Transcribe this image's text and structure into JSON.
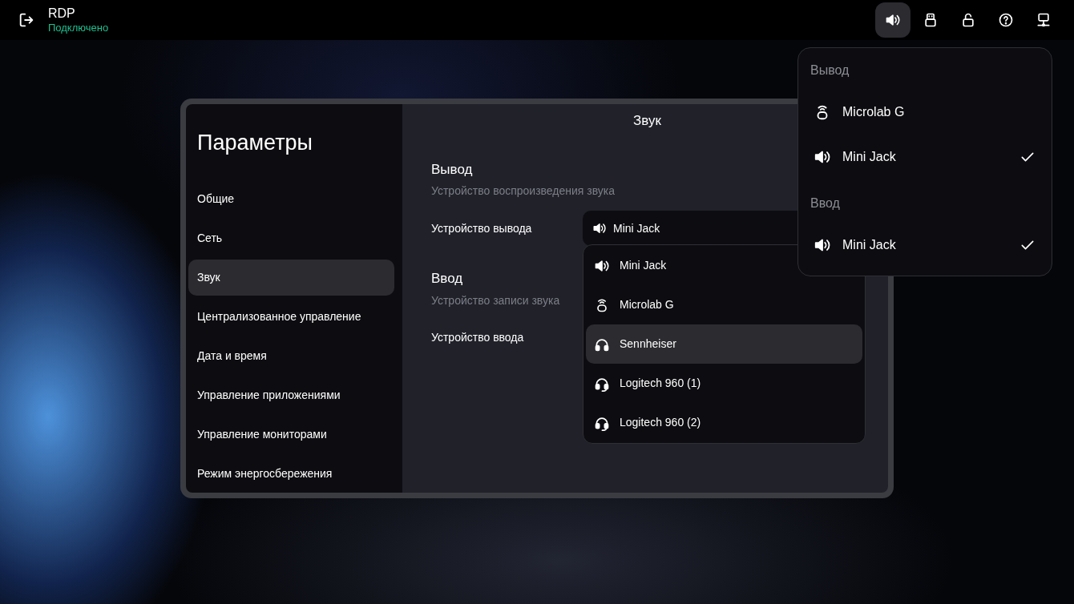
{
  "top_bar": {
    "title": "RDP",
    "status": "Подключено"
  },
  "toolbar": [
    {
      "kind": "sound",
      "selected": true
    },
    {
      "kind": "usb",
      "selected": false
    },
    {
      "kind": "unlock",
      "selected": false
    },
    {
      "kind": "help",
      "selected": false
    },
    {
      "kind": "network",
      "selected": false
    }
  ],
  "settings": {
    "title": "Параметры",
    "sidebar": [
      {
        "label": "Общие",
        "selected": false
      },
      {
        "label": "Сеть",
        "selected": false
      },
      {
        "label": "Звук",
        "selected": true
      },
      {
        "label": "Централизованное управление",
        "selected": false
      },
      {
        "label": "Дата и время",
        "selected": false
      },
      {
        "label": "Управление приложениями",
        "selected": false
      },
      {
        "label": "Управление мониторами",
        "selected": false
      },
      {
        "label": "Режим энергосбережения",
        "selected": false
      }
    ],
    "page_title": "Звук",
    "output": {
      "title": "Вывод",
      "subtitle": "Устройство воспроизведения звука",
      "field_label": "Устройство вывода",
      "value": "Mini Jack"
    },
    "input": {
      "title": "Ввод",
      "subtitle": "Устройство записи звука",
      "field_label": "Устройство ввода"
    },
    "dropdown": [
      {
        "label": "Mini Jack",
        "kind": "speaker",
        "selected": false
      },
      {
        "label": "Microlab G",
        "kind": "wireless",
        "selected": false
      },
      {
        "label": "Sennheiser",
        "kind": "headphones",
        "selected": true
      },
      {
        "label": "Logitech 960 (1)",
        "kind": "headset",
        "selected": false
      },
      {
        "label": "Logitech 960 (2)",
        "kind": "headset",
        "selected": false
      }
    ]
  },
  "sound_menu": [
    {
      "title": "Вывод",
      "items": [
        {
          "label": "Microlab G",
          "kind": "wireless",
          "checked": false
        },
        {
          "label": "Mini Jack",
          "kind": "speaker",
          "checked": true
        }
      ]
    },
    {
      "title": "Ввод",
      "items": [
        {
          "label": "Mini Jack",
          "kind": "speaker",
          "checked": true
        }
      ]
    }
  ]
}
